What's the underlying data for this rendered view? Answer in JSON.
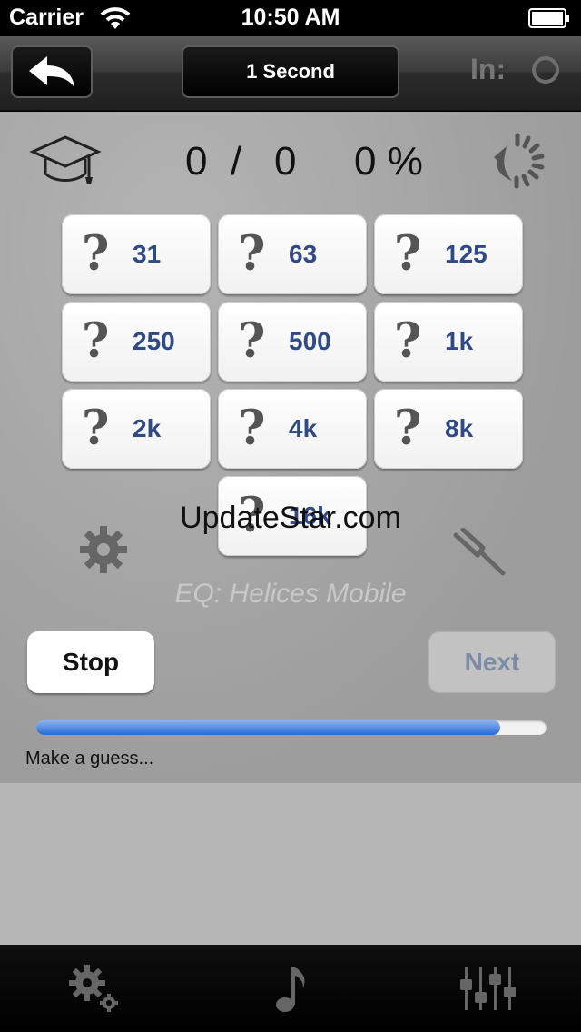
{
  "status_bar": {
    "carrier": "Carrier",
    "time": "10:50 AM"
  },
  "navbar": {
    "duration_label": "1 Second",
    "input_label": "In:"
  },
  "score": {
    "correct": "0",
    "separator": "/",
    "total": "0",
    "percent": "0 %"
  },
  "frequencies": [
    {
      "label": "31"
    },
    {
      "label": "63"
    },
    {
      "label": "125"
    },
    {
      "label": "250"
    },
    {
      "label": "500"
    },
    {
      "label": "1k"
    },
    {
      "label": "2k"
    },
    {
      "label": "4k"
    },
    {
      "label": "8k"
    },
    {
      "label": "16k"
    }
  ],
  "question_glyph": "?",
  "watermark": "UpdateStar.com",
  "eq_label": "EQ: Helices Mobile",
  "buttons": {
    "stop": "Stop",
    "next": "Next"
  },
  "progress": {
    "fraction": 0.91
  },
  "hint": "Make a guess...",
  "icons": {
    "back": "back-arrow-icon",
    "reset": "reset-icon",
    "graduation": "graduation-cap-icon",
    "gear": "gear-icon",
    "fork": "tuning-fork-icon",
    "music": "music-note-icon",
    "eq": "equalizer-icon"
  },
  "colors": {
    "freq_label": "#2f4a86",
    "progress": "#2a6bd6",
    "next_disabled": "#7d8ca6"
  }
}
